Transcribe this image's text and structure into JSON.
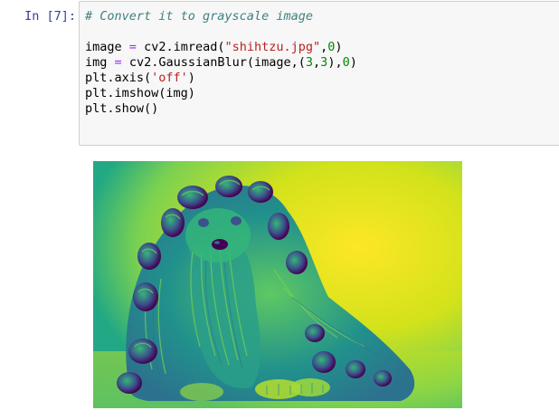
{
  "cell": {
    "prompt": "In [7]:",
    "code_lines": [
      {
        "comment": "# Convert it to grayscale image"
      },
      {
        "var": "image",
        "eq": "=",
        "call": "cv2.imread(",
        "str": "\"shihtzu.jpg\"",
        "sep": ",",
        "num": "0",
        "end": ")"
      },
      {
        "var": "img",
        "eq": "=",
        "call": "cv2.GaussianBlur(image,(",
        "n1": "3",
        "c1": ",",
        "n2": "3",
        "c2": "),",
        "n3": "0",
        "end": ")"
      },
      {
        "pre": "plt.axis(",
        "str": "'off'",
        "end": ")"
      },
      {
        "text": "plt.imshow(img)"
      },
      {
        "text": "plt.show()"
      }
    ]
  },
  "output": {
    "colormap": "viridis",
    "colors": {
      "dark": "#3b528b",
      "mid": "#21918c",
      "light": "#5ec962",
      "bright": "#fde725"
    }
  }
}
